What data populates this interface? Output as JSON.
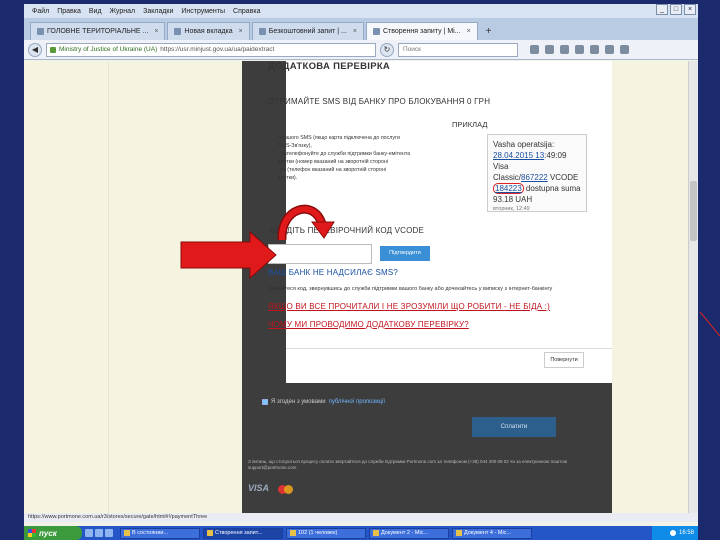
{
  "window": {
    "menu": [
      "Файл",
      "Правка",
      "Вид",
      "Журнал",
      "Закладки",
      "Инструменты",
      "Справка"
    ]
  },
  "tabs": [
    {
      "label": "ГОЛОВНЕ ТЕРИТОРІАЛЬНЕ ...",
      "active": false
    },
    {
      "label": "Новая вкладка",
      "active": false
    },
    {
      "label": "Безкоштовний запит | ...",
      "active": false
    },
    {
      "label": "Створення запиту | Мі...",
      "active": true
    }
  ],
  "tab_new": "+",
  "nav": {
    "back": "◀",
    "reload": "↻",
    "org": "Ministry of Justice of Ukraine (UA)",
    "url": "https://usr.minjust.gov.ua/ua/paidextract",
    "search_placeholder": "Поиск"
  },
  "page": {
    "verify_heading": "ДОДАТКОВА ПЕРЕВІРКА",
    "sms_heading": "ОТРИМАЙТЕ SMS ВІД БАНКУ ПРО БЛОКУВАННЯ 0 ГРН",
    "example_label": "ПРИКЛАД",
    "desc_lines": [
      "першого SMS (якщо карта підключена до послуги",
      "SMS-Зв'язку),",
      "• зателефонуйте до служби підтримки банку-емітента",
      "картки (номер вказаний на зворотній стороні",
      "гри (телефон вказаний на зворотній стороні",
      "картки)."
    ],
    "sms": {
      "l1": "Vasha operatsija:",
      "date": "28.04.2015 13",
      "time_rest": ":49:09 Visa",
      "l3a": "Classic/",
      "card": "867222",
      "l3b": " VCODE",
      "code": "184223",
      "l4b": " dostupna suma",
      "l5": "93.18 UAH",
      "timestamp": "вторник, 12:49"
    },
    "code_label": "ВВЕДІТЬ ПЕРЕВІРОЧНИЙ КОД VCODE",
    "confirm_button": "Підтвердити",
    "no_sms_link": "ВАШ БАНК НЕ НАДСИЛАЄ SMS?",
    "bank_note": "Дізнайтеся код, звернувшись до служби підтримки вашого банку або дочекайтесь у виписку з інтернет-банкінгу",
    "help_link": "ЯКЩО ВИ ВСЕ ПРОЧИТАЛИ І НЕ ЗРОЗУМІЛИ ЩО РОБИТИ - НЕ БІДА :)",
    "why_link": "ЧОМУ МИ ПРОВОДИМО ДОДАТКОВУ ПЕРЕВІРКУ?",
    "back_button": "Повернути",
    "agree_text": "Я згоден з умовами ",
    "agree_link": "публічної пропозиції",
    "pay_button": "Сплатити",
    "footer_note": "З питань, що стосуються процесу оплати звертайтеся до служби підтримки Portmone.com за телефоном (+38) 044 200 09 02 чи за електронною поштою support@portmone.com",
    "visa": "VISA"
  },
  "status": {
    "url": "https://www.portmone.com.ua/r3/stores/secure/gate/html#!/paymentThree"
  },
  "taskbar": {
    "start": "пуск",
    "items": [
      {
        "label": "В состоянии...",
        "active": false
      },
      {
        "label": "Створення запит...",
        "active": true
      },
      {
        "label": "102 (1 человек)",
        "active": false
      },
      {
        "label": "Документ 2 - Mic...",
        "active": false
      },
      {
        "label": "Документ 4 - Mic...",
        "active": false
      }
    ],
    "clock": "16:58"
  },
  "colors": {
    "slide_frame": "#1a2a6c",
    "arrow_red": "#e01a1a",
    "link_blue": "#1a4fa0",
    "link_red": "#c0131b",
    "button_blue": "#3a8fd6"
  }
}
